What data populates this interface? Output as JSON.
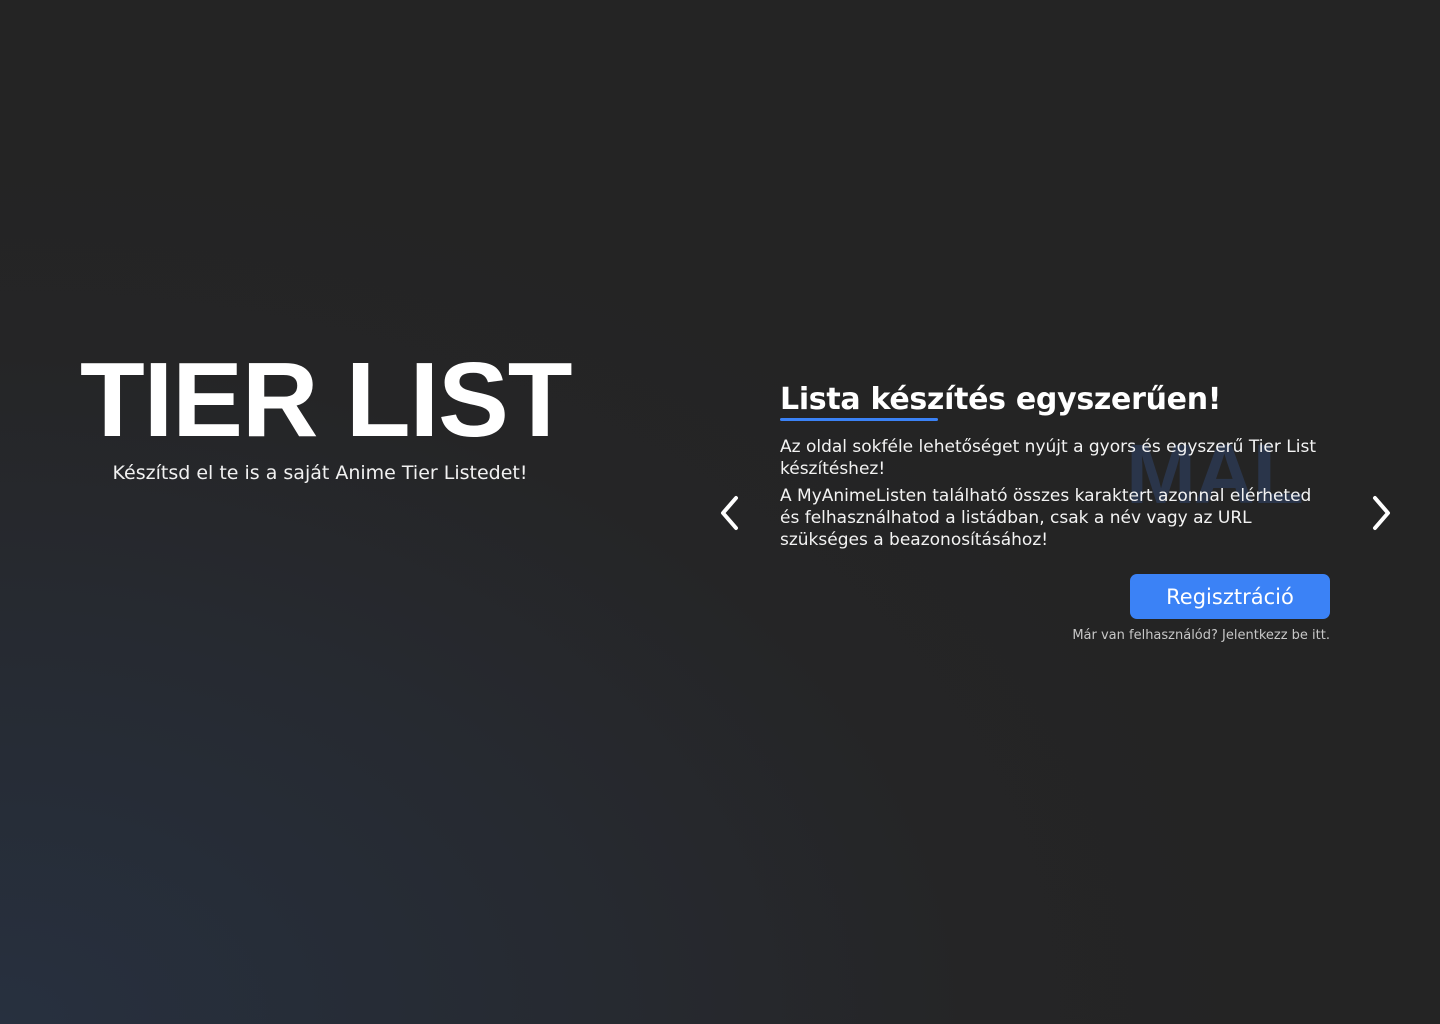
{
  "hero": {
    "title": "TIER LIST",
    "subtitle": "Készítsd el te is a saját Anime Tier Listedet!"
  },
  "carousel": {
    "prev_icon": "chevron-left-icon",
    "next_icon": "chevron-right-icon",
    "slide": {
      "title": "Lista készítés egyszerűen!",
      "paragraph_1": "Az oldal sokféle lehetőséget nyújt a gyors és egyszerű Tier List készítéshez!",
      "paragraph_2": "A MyAnimeListen található összes karaktert azonnal elérheted és felhasználhatod a listádban, csak a név vagy az URL szükséges a beazonosításához!",
      "watermark": "MAL",
      "button_label": "Regisztráció",
      "login_hint": "Már van felhasználód? Jelentkezz be itt."
    }
  },
  "colors": {
    "accent": "#3b82f6",
    "background": "#252526",
    "text": "#ffffff"
  }
}
